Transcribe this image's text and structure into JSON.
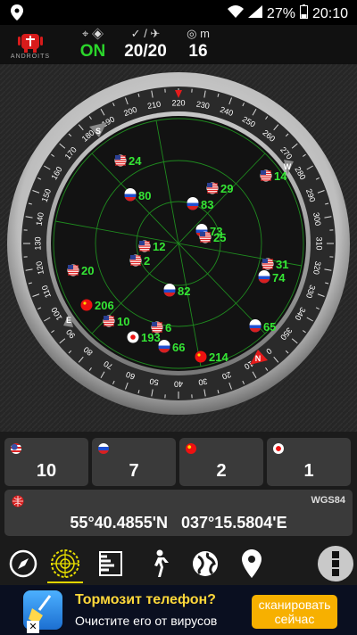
{
  "status_bar": {
    "battery": "27%",
    "time": "20:10"
  },
  "header": {
    "logo_text": "ANDROITS",
    "gps_status": "ON",
    "satellites": "20/20",
    "accuracy_unit": "m",
    "accuracy": "16"
  },
  "compass": {
    "ring_labels": [
      "0",
      "10",
      "20",
      "30",
      "40",
      "50",
      "60",
      "70",
      "80",
      "90",
      "100",
      "110",
      "120",
      "130",
      "140",
      "150",
      "160",
      "170",
      "180",
      "190",
      "200",
      "210",
      "220",
      "230",
      "240",
      "250",
      "260",
      "270",
      "280",
      "290",
      "300",
      "310",
      "320",
      "330",
      "340",
      "350"
    ],
    "cardinal": {
      "N": "N",
      "E": "E",
      "S": "S",
      "W": "W"
    }
  },
  "satellites": [
    {
      "id": "24",
      "flag": "us"
    },
    {
      "id": "14",
      "flag": "us"
    },
    {
      "id": "80",
      "flag": "ru"
    },
    {
      "id": "29",
      "flag": "us"
    },
    {
      "id": "83",
      "flag": "ru"
    },
    {
      "id": "73",
      "flag": "ru"
    },
    {
      "id": "25",
      "flag": "us"
    },
    {
      "id": "12",
      "flag": "us"
    },
    {
      "id": "2",
      "flag": "us"
    },
    {
      "id": "31",
      "flag": "us"
    },
    {
      "id": "20",
      "flag": "us"
    },
    {
      "id": "74",
      "flag": "ru"
    },
    {
      "id": "82",
      "flag": "ru"
    },
    {
      "id": "206",
      "flag": "cn"
    },
    {
      "id": "10",
      "flag": "us"
    },
    {
      "id": "6",
      "flag": "us"
    },
    {
      "id": "65",
      "flag": "ru"
    },
    {
      "id": "193",
      "flag": "jp"
    },
    {
      "id": "66",
      "flag": "ru"
    },
    {
      "id": "214",
      "flag": "cn"
    }
  ],
  "counts": [
    {
      "flag": "us",
      "count": "10"
    },
    {
      "flag": "ru",
      "count": "7"
    },
    {
      "flag": "cn",
      "count": "2"
    },
    {
      "flag": "jp",
      "count": "1"
    }
  ],
  "location": {
    "datum": "WGS84",
    "coords": "55°40.4855'N   037°15.5804'E"
  },
  "toolbar": [
    "compass-icon",
    "radar-icon",
    "signal-bars-icon",
    "walking-icon",
    "globe-icon",
    "map-pin-icon",
    "menu-icon"
  ],
  "ad": {
    "title": "Тормозит телефон?",
    "subtitle": "Очистите его от вирусов",
    "button": "сканировать сейчас",
    "button_line1": "сканировать",
    "button_line2": "сейчас",
    "close": "✕"
  }
}
